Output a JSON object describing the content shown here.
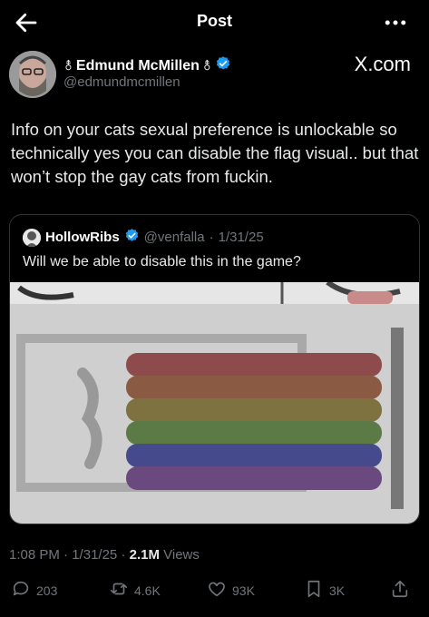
{
  "header": {
    "title": "Post"
  },
  "post": {
    "author_name": "Edmund McMillen",
    "handle": "@edmundmcmillen",
    "name_glyph": "⚨",
    "source_label": "X.com",
    "text": "Info on your cats sexual preference is unlockable so technically yes you can disable the flag visual.. but that won’t stop the gay cats from fuckin."
  },
  "quote": {
    "author_name": "HollowRibs",
    "handle": "@venfalla",
    "date": "1/31/25",
    "text": "Will we be able to disable this in the game?",
    "flag_colors": [
      "#8e4b4b",
      "#8a5a42",
      "#7d7240",
      "#5c7a45",
      "#454a8c",
      "#6a4a7e"
    ]
  },
  "meta": {
    "time": "1:08 PM",
    "date": "1/31/25",
    "views_count": "2.1M",
    "views_label": "Views"
  },
  "actions": {
    "replies": "203",
    "reposts": "4.6K",
    "likes": "93K",
    "bookmarks": "3K"
  },
  "colors": {
    "background": "#000000",
    "verified": "#1d9bf0",
    "secondary_text": "#71767b"
  }
}
